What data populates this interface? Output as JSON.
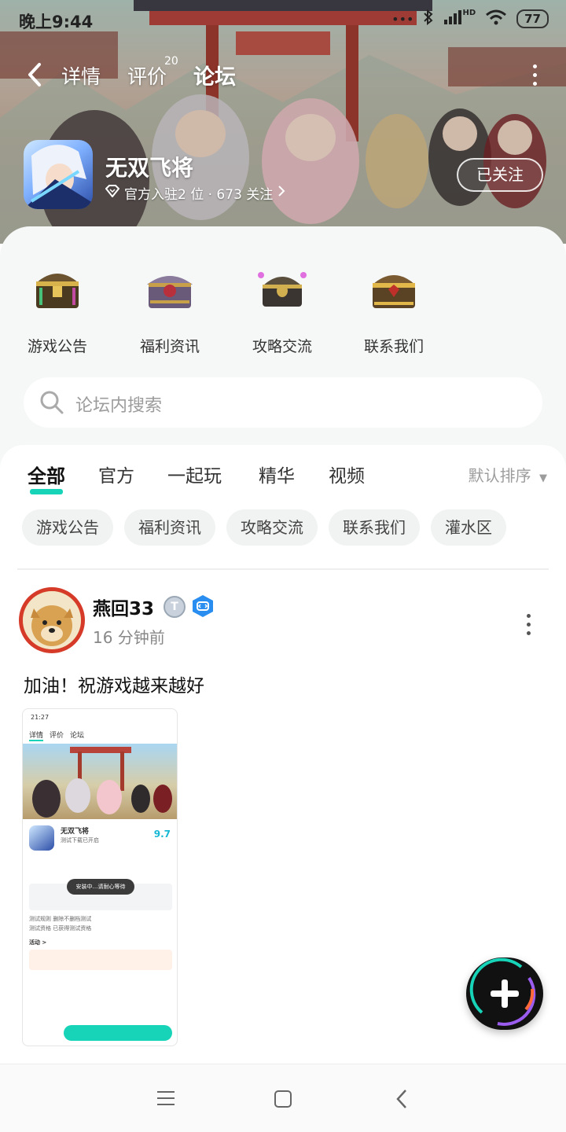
{
  "status_bar": {
    "time": "晚上9:44",
    "hd": "HD",
    "battery": "77"
  },
  "nav": {
    "detail_tab": "详情",
    "review_tab": "评价",
    "review_count": "20",
    "forum_tab": "论坛"
  },
  "game": {
    "name": "无双飞将",
    "meta": "官方入驻2 位 · 673 关注",
    "follow_label": "已关注"
  },
  "shortcuts": [
    {
      "label": "游戏公告",
      "icon": "gold-chest-icon"
    },
    {
      "label": "福利资讯",
      "icon": "purple-chest-icon"
    },
    {
      "label": "攻略交流",
      "icon": "dark-chest-icon"
    },
    {
      "label": "联系我们",
      "icon": "treasure-chest-icon"
    }
  ],
  "search": {
    "placeholder": "论坛内搜索"
  },
  "tabs": [
    "全部",
    "官方",
    "一起玩",
    "精华",
    "视频"
  ],
  "sort_label": "默认排序",
  "chips": [
    "游戏公告",
    "福利资讯",
    "攻略交流",
    "联系我们",
    "灌水区"
  ],
  "post": {
    "author": "燕回33",
    "time": "16 分钟前",
    "text": "加油！祝游戏越来越好",
    "thumbnail": {
      "status_time": "21:27",
      "nav": [
        "详情",
        "评价",
        "论坛"
      ],
      "game_name": "无双飞将",
      "subtitle": "测试下载已开启",
      "score": "9.7",
      "toast": "安装中…请耐心等待",
      "row1": "测试规则    删除不删档测试",
      "row2": "测试资格    已获得测试资格",
      "activity": "活动 >"
    }
  },
  "colors": {
    "accent": "#17d4b9",
    "avatar_ring": "#d63a28",
    "fab": "#111111"
  }
}
